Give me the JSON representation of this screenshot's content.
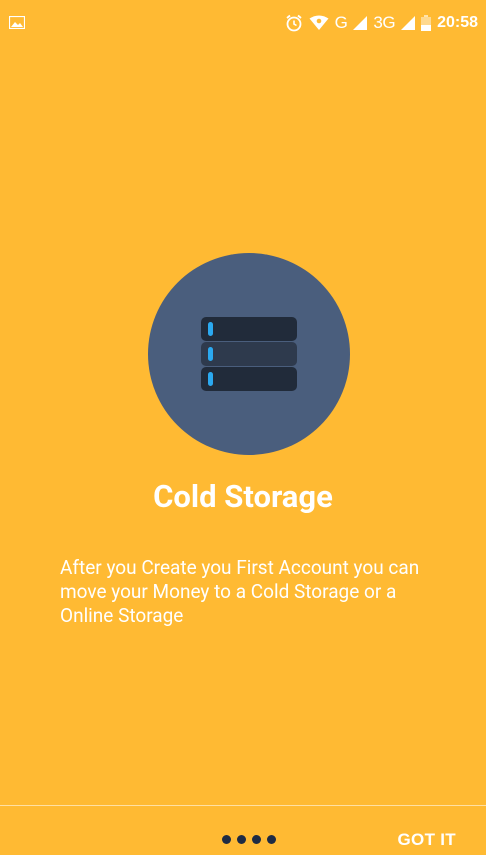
{
  "status_bar": {
    "left_icon": "image-icon",
    "icons": [
      "alarm-icon",
      "wifi-icon",
      "signal-icon",
      "signal-icon",
      "battery-icon"
    ],
    "network_1": "G",
    "network_2": "3G",
    "time": "20:58"
  },
  "onboarding": {
    "illustration_icon": "storage-server-icon",
    "title": "Cold Storage",
    "description": "After you Create you First Account you can move your Money to a Cold Storage or a Online Storage"
  },
  "footer": {
    "page_count": 4,
    "got_it_label": "GOT IT"
  },
  "colors": {
    "background": "#FFBA33",
    "circle": "#4A5E7D",
    "server_block": "#212B3A",
    "server_block_mid": "#2E3A4D",
    "indicator": "#2BA9F0",
    "dot": "#1E2B44"
  }
}
